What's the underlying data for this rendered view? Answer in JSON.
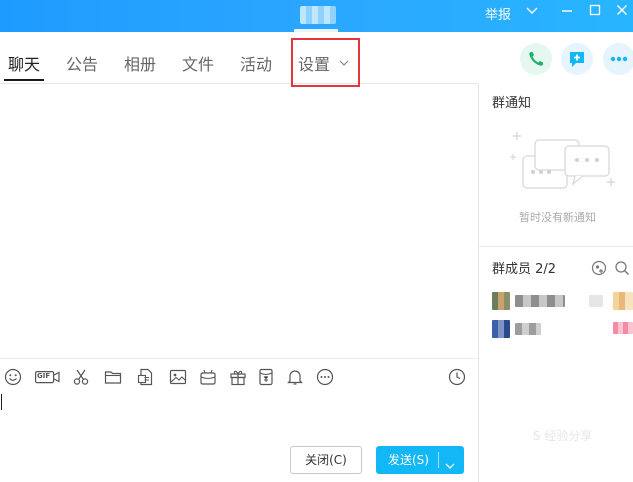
{
  "titlebar": {
    "report_label": "举报"
  },
  "tabs": [
    {
      "label": "聊天"
    },
    {
      "label": "公告"
    },
    {
      "label": "相册"
    },
    {
      "label": "文件"
    },
    {
      "label": "活动"
    },
    {
      "label": "设置"
    }
  ],
  "right_panel": {
    "notice_title": "群通知",
    "notice_empty": "暂时没有新通知",
    "members_title": "群成员 2/2"
  },
  "toolbar": {
    "gif_label": "GIF"
  },
  "buttons": {
    "close_label": "关闭(C)",
    "send_label": "发送(S)"
  },
  "watermark": "S 经验分享",
  "colors": {
    "titlebar": "#1e9bff",
    "accent": "#12b7f5",
    "highlight_box": "#e0383e"
  }
}
